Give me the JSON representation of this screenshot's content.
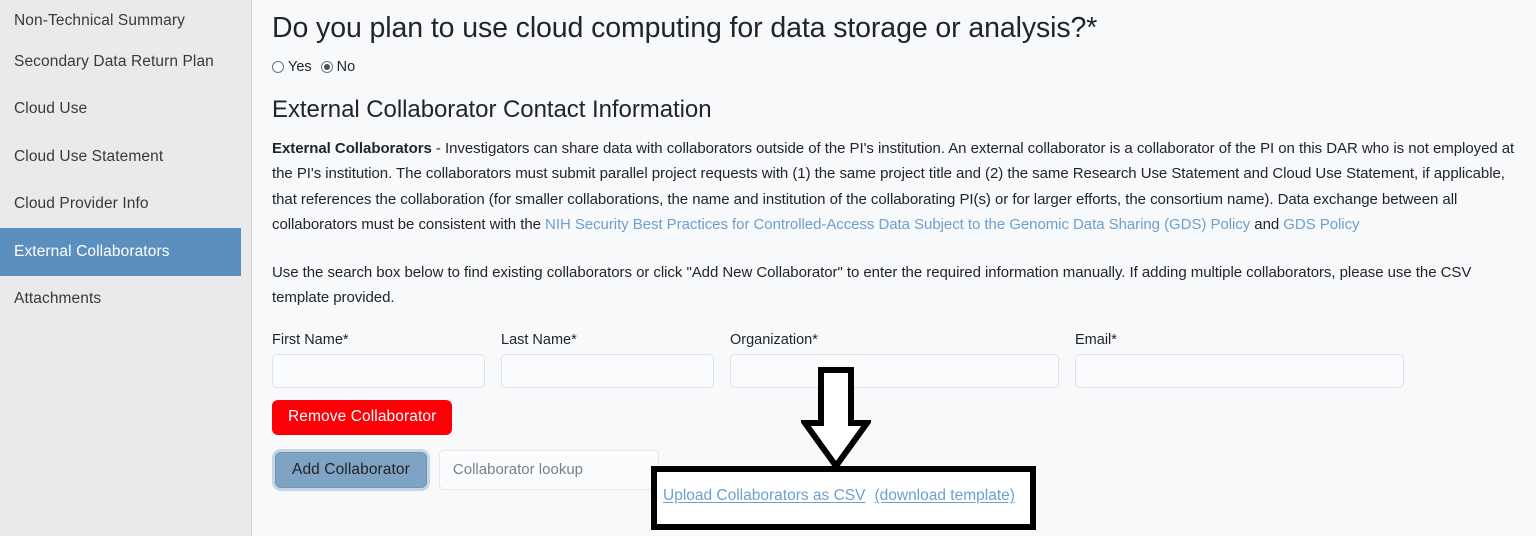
{
  "sidebar": {
    "items": [
      {
        "label": "Non-Technical Summary",
        "active": false
      },
      {
        "label": "Secondary Data Return Plan",
        "active": false
      },
      {
        "label": "Cloud Use",
        "active": false
      },
      {
        "label": "Cloud Use Statement",
        "active": false
      },
      {
        "label": "Cloud Provider Info",
        "active": false
      },
      {
        "label": "External Collaborators",
        "active": true
      },
      {
        "label": "Attachments",
        "active": false
      }
    ],
    "active_bg": "#5b8fbd",
    "bg": "#eaeaea"
  },
  "main": {
    "question_title": "Do you plan to use cloud computing for data storage or analysis?*",
    "radio": {
      "options": [
        {
          "label": "Yes",
          "selected": false
        },
        {
          "label": "No",
          "selected": true
        }
      ]
    },
    "section_title": "External Collaborator Contact Information",
    "paragraph1": {
      "lead": "External Collaborators",
      "text_before_link": " - Investigators can share data with collaborators outside of the PI's institution. An external collaborator is a collaborator of the PI on this DAR who is not employed at the PI's institution. The collaborators must submit parallel project requests with (1) the same project title and (2) the same Research Use Statement and Cloud Use Statement, if applicable, that references the collaboration (for smaller collaborations, the name and institution of the collaborating PI(s) or for larger efforts, the consortium name). Data exchange between all collaborators must be consistent with the ",
      "link1": "NIH Security Best Practices for Controlled-Access Data Subject to the Genomic Data Sharing (GDS) Policy",
      "text_mid": " and ",
      "link2": "GDS Policy",
      "link_color": "#6d9fd0"
    },
    "paragraph2": "Use the search box below to find existing collaborators or click \"Add New Collaborator\" to enter the required information manually. If adding multiple collaborators, please use the CSV template provided.",
    "form": {
      "fields": [
        {
          "label": "First Name*",
          "value": "",
          "placeholder": ""
        },
        {
          "label": "Last Name*",
          "value": "",
          "placeholder": ""
        },
        {
          "label": "Organization*",
          "value": "",
          "placeholder": ""
        },
        {
          "label": "Email*",
          "value": "",
          "placeholder": ""
        }
      ]
    },
    "buttons": {
      "remove_collaborator": "Remove Collaborator",
      "remove_collaborator_color": "#fb0007",
      "add_collaborator": "Add Collaborator",
      "add_collaborator_color": "#7fa3c3",
      "lookup_placeholder": "Collaborator lookup",
      "lookup_value": ""
    },
    "csv": {
      "upload_link": "Upload Collaborators as CSV",
      "download_link": "(download template)"
    }
  }
}
